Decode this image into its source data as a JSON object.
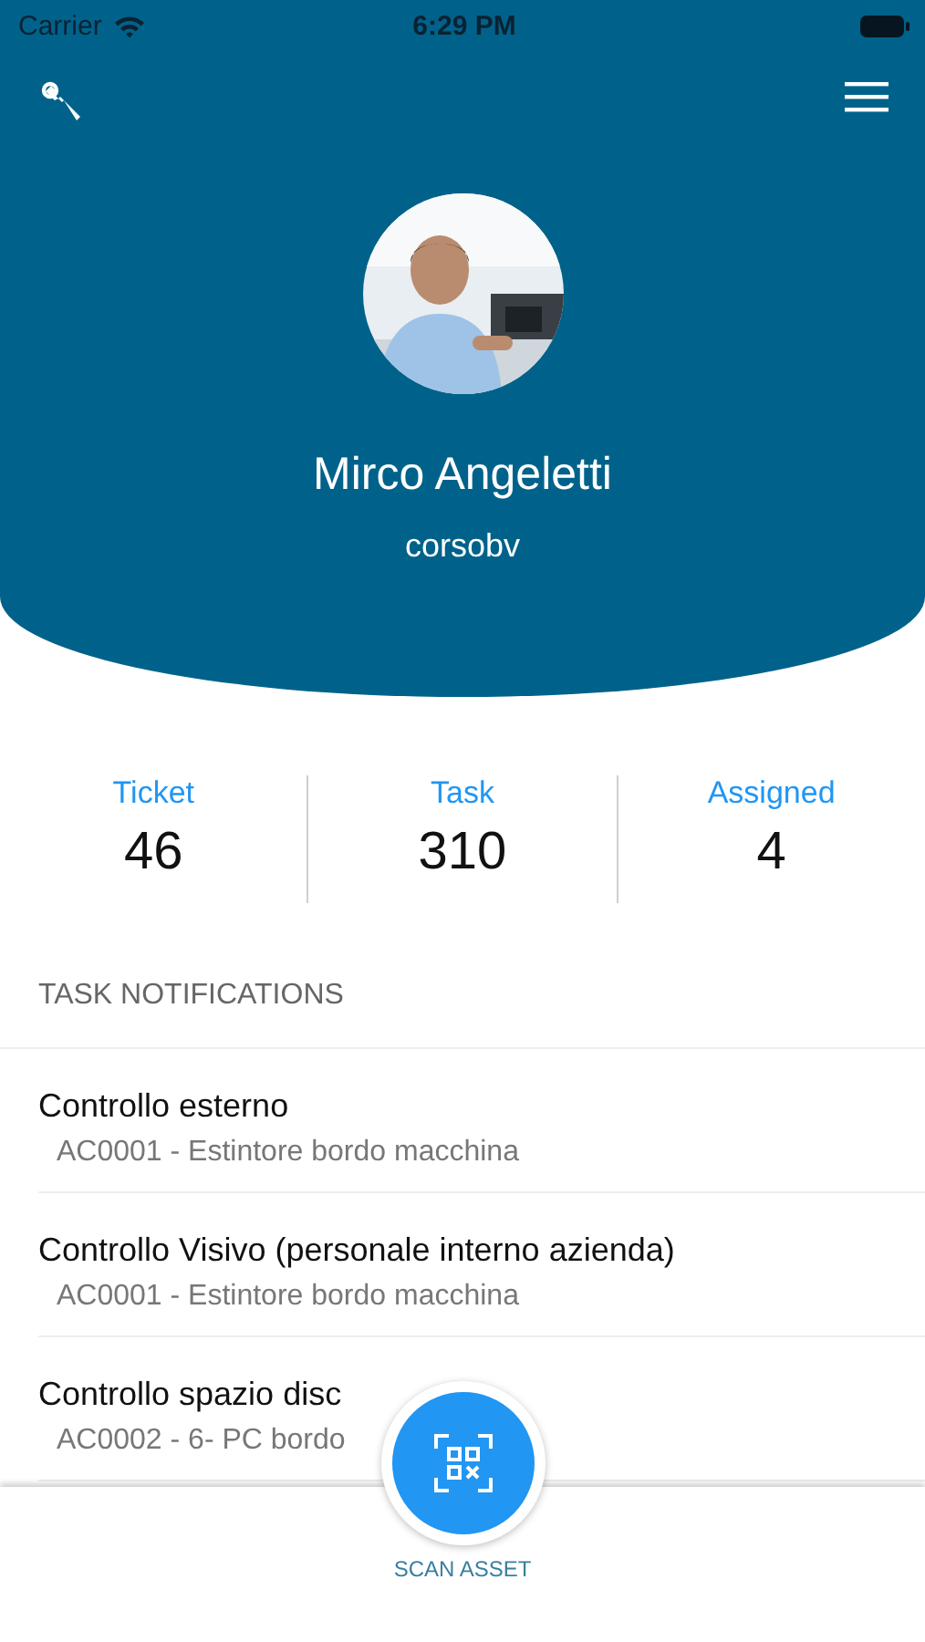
{
  "status_bar": {
    "carrier": "Carrier",
    "time": "6:29 PM"
  },
  "profile": {
    "name": "Mirco Angeletti",
    "username": "corsobv"
  },
  "stats": [
    {
      "label": "Ticket",
      "value": "46"
    },
    {
      "label": "Task",
      "value": "310"
    },
    {
      "label": "Assigned",
      "value": "4"
    }
  ],
  "section_title": "TASK NOTIFICATIONS",
  "notifications": [
    {
      "title": "Controllo esterno",
      "subtitle": "AC0001 - Estintore bordo macchina"
    },
    {
      "title": "Controllo Visivo (personale interno azienda)",
      "subtitle": "AC0001 - Estintore bordo macchina"
    },
    {
      "title": "Controllo spazio disc",
      "subtitle": "AC0002 - 6- PC bordo"
    }
  ],
  "scan_button": {
    "label": "SCAN ASSET"
  }
}
